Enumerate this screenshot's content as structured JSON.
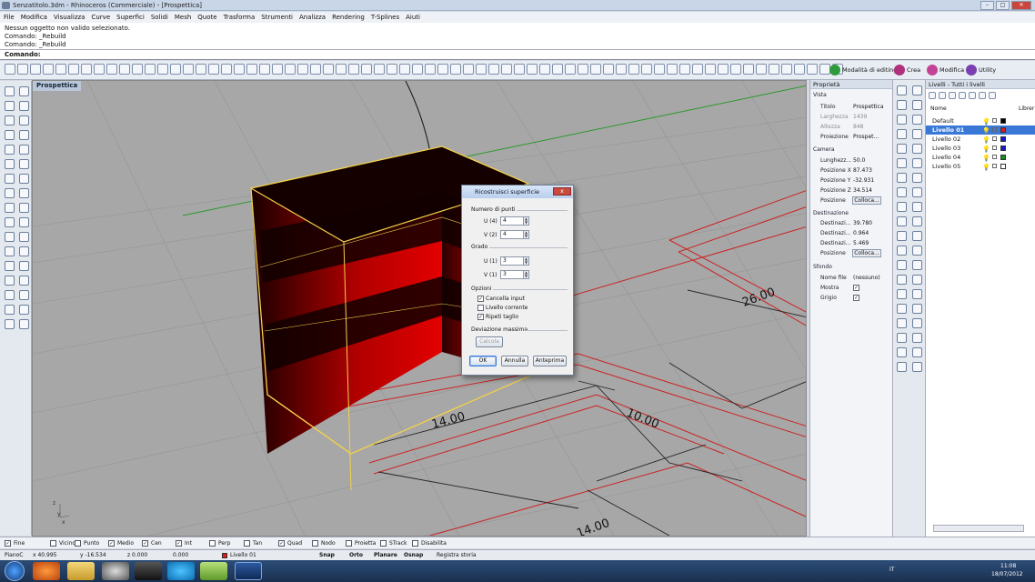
{
  "window": {
    "title": "Senzatitolo.3dm - Rhinoceros (Commerciale) - [Prospettica]"
  },
  "menu": [
    "File",
    "Modifica",
    "Visualizza",
    "Curve",
    "Superfici",
    "Solidi",
    "Mesh",
    "Quote",
    "Trasforma",
    "Strumenti",
    "Analizza",
    "Rendering",
    "T-Splines",
    "Aiuti"
  ],
  "command_history": [
    "Nessun oggetto non valido selezionato.",
    "Comando: _Rebuild",
    "Comando: _Rebuild"
  ],
  "command_prompt": "Comando:",
  "toolbar_tabs": [
    {
      "label": "Modalità di editing",
      "color": "#2f9a3c"
    },
    {
      "label": "Crea",
      "color": "#b0307c"
    },
    {
      "label": "Modifica",
      "color": "#c24296"
    },
    {
      "label": "Utility",
      "color": "#7a3fb0"
    }
  ],
  "viewport": {
    "label": "Prospettica",
    "dimensions": [
      "26.00",
      "14.00",
      "10.00",
      "14.00"
    ],
    "axes": {
      "x": "x",
      "y": "y",
      "z": "z"
    }
  },
  "properties": {
    "title": "Proprietà",
    "sections": {
      "vista": "Vista",
      "camera": "Camera",
      "destinazione": "Destinazione",
      "sfondo": "Sfondo"
    },
    "vista": [
      {
        "k": "Titolo",
        "v": "Prospettica",
        "dim": false
      },
      {
        "k": "Larghezza",
        "v": "1439",
        "dim": true
      },
      {
        "k": "Altezza",
        "v": "848",
        "dim": true
      },
      {
        "k": "Proiezione",
        "v": "Prospet...",
        "dim": false
      }
    ],
    "camera": [
      {
        "k": "Lunghezz...",
        "v": "50.0"
      },
      {
        "k": "Posizione X",
        "v": "87.473"
      },
      {
        "k": "Posizione Y",
        "v": "-32.931"
      },
      {
        "k": "Posizione Z",
        "v": "34.514"
      },
      {
        "k": "Posizione",
        "v": "Colloca..."
      }
    ],
    "destinazione": [
      {
        "k": "Destinazi...",
        "v": "39.780"
      },
      {
        "k": "Destinazi...",
        "v": "0.964"
      },
      {
        "k": "Destinazi...",
        "v": "5.469"
      },
      {
        "k": "Posizione",
        "v": "Colloca..."
      }
    ],
    "sfondo": [
      {
        "k": "Nome file",
        "v": "(nessuno)"
      },
      {
        "k": "Mostra",
        "v": "✓"
      },
      {
        "k": "Grigio",
        "v": "✓"
      }
    ]
  },
  "layers": {
    "title": "Livelli - Tutti i livelli",
    "col_name": "Nome",
    "col_lib": "Librer",
    "items": [
      {
        "name": "Default",
        "color": "#000000",
        "selected": false
      },
      {
        "name": "Livello 01",
        "color": "#e01818",
        "selected": true
      },
      {
        "name": "Livello 02",
        "color": "#1a1acc",
        "selected": false
      },
      {
        "name": "Livello 03",
        "color": "#1a1acc",
        "selected": false
      },
      {
        "name": "Livello 04",
        "color": "#1a8c1a",
        "selected": false
      },
      {
        "name": "Livello 05",
        "color": "#ffffff",
        "selected": false
      }
    ]
  },
  "dialog": {
    "title": "Ricostruisci superficie",
    "group_points": "Numero di punti",
    "u_points_label": "U (4)",
    "u_points": "4",
    "v_points_label": "V (2)",
    "v_points": "4",
    "group_degree": "Grado",
    "u_degree_label": "U (1)",
    "u_degree": "3",
    "v_degree_label": "V (1)",
    "v_degree": "3",
    "group_options": "Opzioni",
    "opt_delete": "Cancella input",
    "opt_layer": "Livello corrente",
    "opt_trim": "Ripeti taglio",
    "group_deviation": "Deviazione massima",
    "calc": "Calcola",
    "ok": "OK",
    "cancel": "Annulla",
    "preview": "Anteprima",
    "close": "x"
  },
  "osnap": [
    {
      "label": "Fine",
      "checked": true
    },
    {
      "label": "Vicino",
      "checked": false
    },
    {
      "label": "Punto",
      "checked": false
    },
    {
      "label": "Medio",
      "checked": true
    },
    {
      "label": "Cen",
      "checked": true
    },
    {
      "label": "Int",
      "checked": true
    },
    {
      "label": "Perp",
      "checked": false
    },
    {
      "label": "Tan",
      "checked": false
    },
    {
      "label": "Quad",
      "checked": true
    },
    {
      "label": "Nodo",
      "checked": false
    },
    {
      "label": "Proietta",
      "checked": false
    },
    {
      "label": "STrack",
      "checked": false
    },
    {
      "label": "Disabilita",
      "checked": false
    }
  ],
  "status": {
    "plane": "PianoC",
    "x": "x 40.995",
    "y": "y -16.534",
    "z": "z 0.000",
    "dist": "0.000",
    "layer": "Livello 01",
    "layer_color": "#e01818",
    "snap": "Snap",
    "orto": "Orto",
    "planare": "Planare",
    "osnap": "Osnap",
    "registra": "Registra storia"
  },
  "tray": {
    "lang": "IT",
    "time": "11:08",
    "date": "18/07/2012"
  }
}
